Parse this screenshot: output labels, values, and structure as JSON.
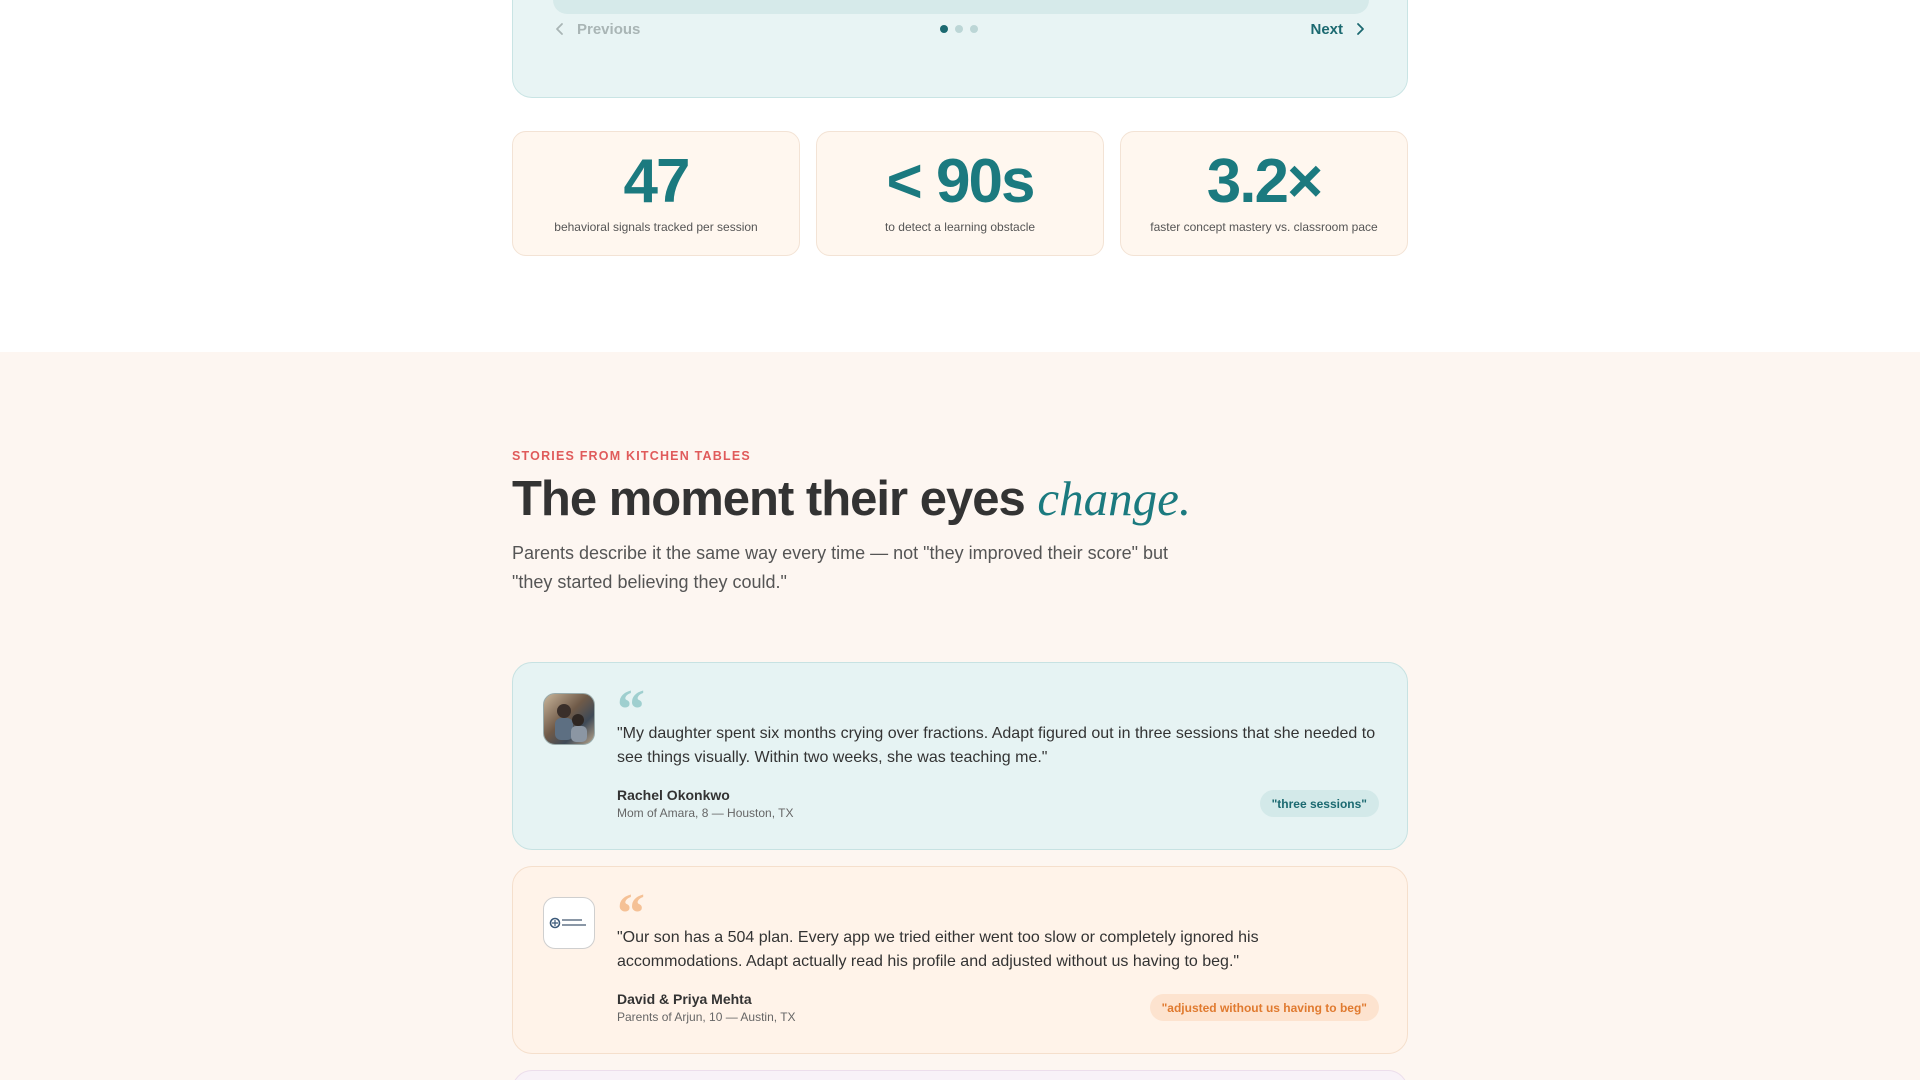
{
  "carousel": {
    "prev_label": "Previous",
    "next_label": "Next",
    "dots": 3,
    "active_dot": 0
  },
  "stats": [
    {
      "value": "47",
      "label": "behavioral signals tracked per session"
    },
    {
      "value": "< 90s",
      "label": "to detect a learning obstacle"
    },
    {
      "value": "3.2×",
      "label": "faster concept mastery vs. classroom pace"
    }
  ],
  "stories": {
    "eyebrow": "STORIES FROM KITCHEN TABLES",
    "headline_main": "The moment their eyes ",
    "headline_accent": "change.",
    "subcopy": "Parents describe it the same way every time — not \"they improved their score\" but \"they started believing they could.\"",
    "testimonials": [
      {
        "quote": "\"My daughter spent six months crying over fractions. Adapt figured out in three sessions that she needed to see things visually. Within two weeks, she was teaching me.\"",
        "name": "Rachel Okonkwo",
        "meta": "Mom of Amara, 8 — Houston, TX",
        "tag": "\"three sessions\""
      },
      {
        "quote": "\"Our son has a 504 plan. Every app we tried either went too slow or completely ignored his accommodations. Adapt actually read his profile and adjusted without us having to beg.\"",
        "name": "David & Priya Mehta",
        "meta": "Parents of Arjun, 10 — Austin, TX",
        "tag": "\"adjusted without us having to beg\""
      }
    ]
  },
  "colors": {
    "teal": "#1b7a7f",
    "coral": "#e05b5b",
    "orange": "#e07a2f"
  }
}
